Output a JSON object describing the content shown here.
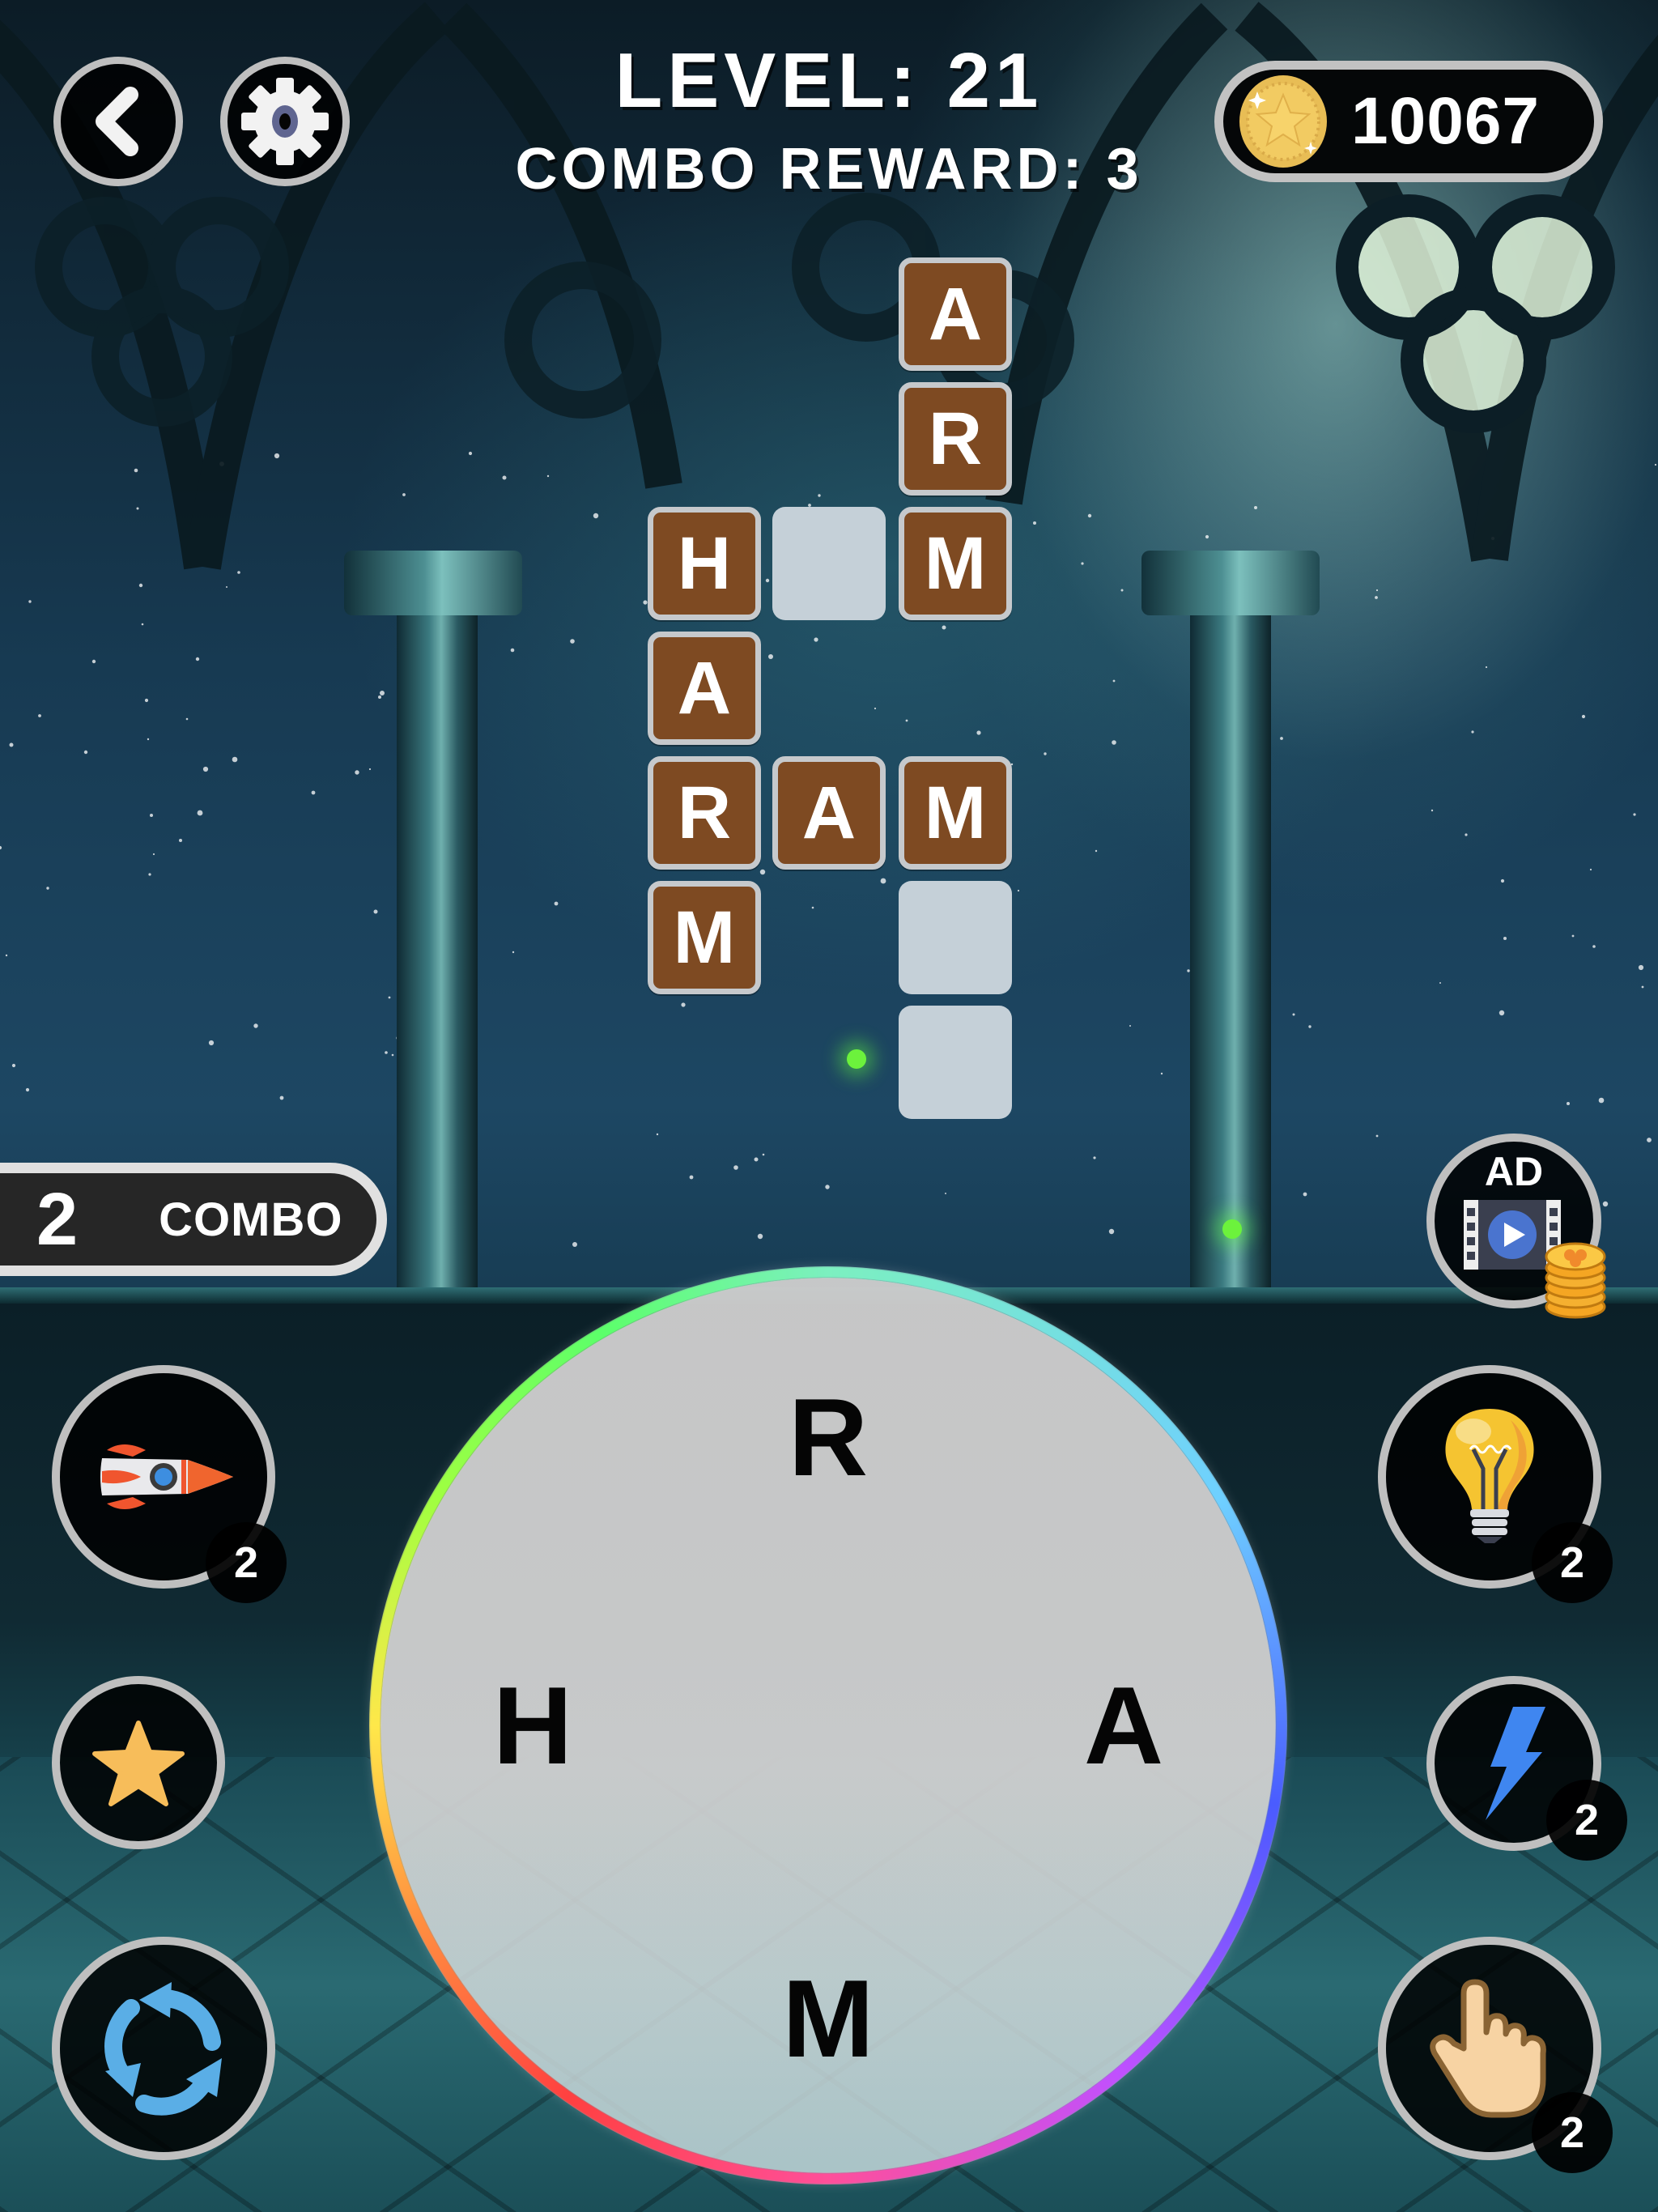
{
  "header": {
    "level_label": "LEVEL: 21",
    "combo_reward_label": "COMBO REWARD: 3",
    "coins": "10067",
    "back_icon": "chevron-left-icon",
    "settings_icon": "gear-icon",
    "coin_icon": "star-coin-icon"
  },
  "board": {
    "tiles": [
      {
        "row": 0,
        "col": 2,
        "letter": "A",
        "revealed": true
      },
      {
        "row": 1,
        "col": 2,
        "letter": "R",
        "revealed": true
      },
      {
        "row": 2,
        "col": 0,
        "letter": "H",
        "revealed": true
      },
      {
        "row": 2,
        "col": 1,
        "letter": "",
        "revealed": false
      },
      {
        "row": 2,
        "col": 2,
        "letter": "M",
        "revealed": true
      },
      {
        "row": 3,
        "col": 0,
        "letter": "A",
        "revealed": true
      },
      {
        "row": 4,
        "col": 0,
        "letter": "R",
        "revealed": true
      },
      {
        "row": 4,
        "col": 1,
        "letter": "A",
        "revealed": true
      },
      {
        "row": 4,
        "col": 2,
        "letter": "M",
        "revealed": true
      },
      {
        "row": 5,
        "col": 0,
        "letter": "M",
        "revealed": true
      },
      {
        "row": 5,
        "col": 2,
        "letter": "",
        "revealed": false
      },
      {
        "row": 6,
        "col": 2,
        "letter": "",
        "revealed": false
      }
    ],
    "tile_color": "#7e4a22",
    "empty_tile_color": "#c5d0d8"
  },
  "combo": {
    "count": "2",
    "label": "COMBO"
  },
  "ad_button": {
    "label": "AD",
    "icon": "video-play-icon",
    "reward_icon": "coin-stack-icon"
  },
  "powerups": {
    "left": [
      {
        "name": "rocket",
        "icon": "rocket-icon",
        "count": "2"
      },
      {
        "name": "favorite",
        "icon": "star-icon",
        "count": null
      },
      {
        "name": "shuffle",
        "icon": "shuffle-arrows-icon",
        "count": null
      }
    ],
    "right": [
      {
        "name": "hint",
        "icon": "lightbulb-icon",
        "count": "2"
      },
      {
        "name": "lightning",
        "icon": "lightning-bolt-icon",
        "count": "2"
      },
      {
        "name": "finger-reveal",
        "icon": "pointing-hand-icon",
        "count": "2"
      }
    ]
  },
  "wheel": {
    "letters": [
      "R",
      "A",
      "M",
      "H"
    ]
  }
}
